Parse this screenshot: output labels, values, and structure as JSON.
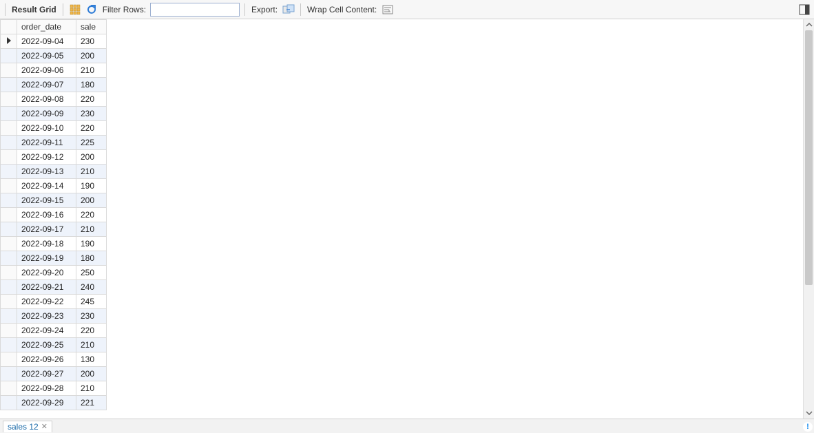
{
  "toolbar": {
    "result_grid_label": "Result Grid",
    "filter_label": "Filter Rows:",
    "filter_value": "",
    "filter_placeholder": "",
    "export_label": "Export:",
    "wrap_label": "Wrap Cell Content:"
  },
  "table": {
    "columns": [
      "order_date",
      "sale"
    ],
    "rows": [
      {
        "order_date": "2022-09-04",
        "sale": "230",
        "current": true
      },
      {
        "order_date": "2022-09-05",
        "sale": "200"
      },
      {
        "order_date": "2022-09-06",
        "sale": "210"
      },
      {
        "order_date": "2022-09-07",
        "sale": "180"
      },
      {
        "order_date": "2022-09-08",
        "sale": "220"
      },
      {
        "order_date": "2022-09-09",
        "sale": "230"
      },
      {
        "order_date": "2022-09-10",
        "sale": "220"
      },
      {
        "order_date": "2022-09-11",
        "sale": "225"
      },
      {
        "order_date": "2022-09-12",
        "sale": "200"
      },
      {
        "order_date": "2022-09-13",
        "sale": "210"
      },
      {
        "order_date": "2022-09-14",
        "sale": "190"
      },
      {
        "order_date": "2022-09-15",
        "sale": "200"
      },
      {
        "order_date": "2022-09-16",
        "sale": "220"
      },
      {
        "order_date": "2022-09-17",
        "sale": "210"
      },
      {
        "order_date": "2022-09-18",
        "sale": "190"
      },
      {
        "order_date": "2022-09-19",
        "sale": "180"
      },
      {
        "order_date": "2022-09-20",
        "sale": "250"
      },
      {
        "order_date": "2022-09-21",
        "sale": "240"
      },
      {
        "order_date": "2022-09-22",
        "sale": "245"
      },
      {
        "order_date": "2022-09-23",
        "sale": "230"
      },
      {
        "order_date": "2022-09-24",
        "sale": "220"
      },
      {
        "order_date": "2022-09-25",
        "sale": "210"
      },
      {
        "order_date": "2022-09-26",
        "sale": "130"
      },
      {
        "order_date": "2022-09-27",
        "sale": "200"
      },
      {
        "order_date": "2022-09-28",
        "sale": "210"
      },
      {
        "order_date": "2022-09-29",
        "sale": "221"
      }
    ]
  },
  "tab": {
    "label": "sales 12"
  },
  "icons": {
    "info": "!"
  }
}
